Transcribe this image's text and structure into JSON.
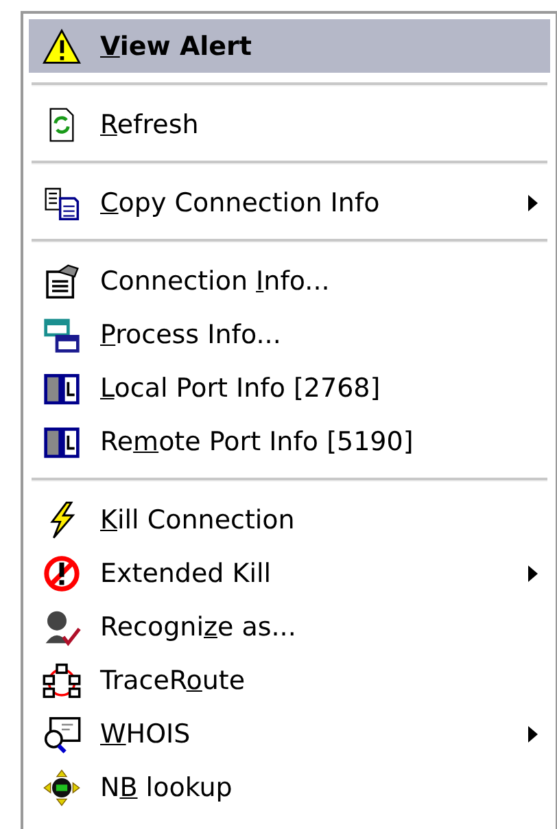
{
  "menu": {
    "sections": [
      {
        "items": [
          {
            "kind": "warning",
            "key": "V",
            "after": "iew Alert",
            "selected": true,
            "default": true,
            "submenu": false
          }
        ]
      },
      {
        "items": [
          {
            "kind": "refresh",
            "key": "R",
            "after": "efresh",
            "selected": false,
            "default": false,
            "submenu": false
          }
        ]
      },
      {
        "items": [
          {
            "kind": "copy",
            "key": "C",
            "after": "opy Connection Info",
            "selected": false,
            "default": false,
            "submenu": true
          }
        ]
      },
      {
        "items": [
          {
            "kind": "connection",
            "before": "Connection ",
            "key": "I",
            "after": "nfo...",
            "selected": false,
            "default": false,
            "submenu": false
          },
          {
            "kind": "process",
            "key": "P",
            "after": "rocess Info...",
            "selected": false,
            "default": false,
            "submenu": false
          },
          {
            "kind": "local",
            "key": "L",
            "after": "ocal Port Info [2768]",
            "selected": false,
            "default": false,
            "submenu": false
          },
          {
            "kind": "remote",
            "before": "Re",
            "key": "m",
            "after": "ote Port Info [5190]",
            "selected": false,
            "default": false,
            "submenu": false
          }
        ]
      },
      {
        "items": [
          {
            "kind": "kill",
            "key": "K",
            "after": "ill Connection",
            "selected": false,
            "default": false,
            "submenu": false
          },
          {
            "kind": "extended",
            "before": "Extended Kill",
            "selected": false,
            "default": false,
            "submenu": true
          },
          {
            "kind": "recognize",
            "before": "Recogni",
            "key": "z",
            "after": "e as...",
            "selected": false,
            "default": false,
            "submenu": false
          },
          {
            "kind": "trace",
            "before": "TraceR",
            "key": "o",
            "after": "ute",
            "selected": false,
            "default": false,
            "submenu": false
          },
          {
            "kind": "whois",
            "key": "W",
            "after": "HOIS",
            "selected": false,
            "default": false,
            "submenu": true
          },
          {
            "kind": "nb",
            "before": "N",
            "key": "B",
            "after": " lookup",
            "selected": false,
            "default": false,
            "submenu": false
          }
        ]
      }
    ]
  }
}
